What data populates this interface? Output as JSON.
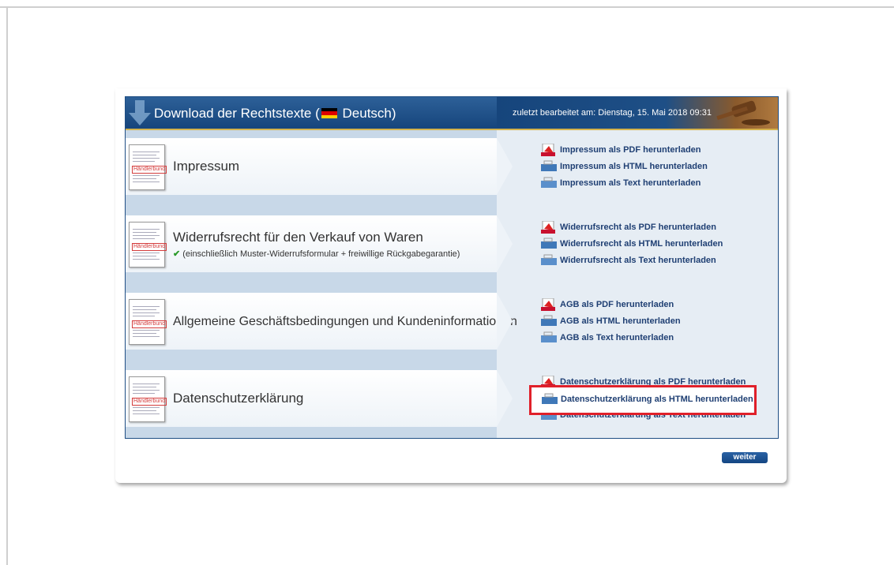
{
  "header": {
    "title_prefix": "Download der Rechtstexte (",
    "title_lang": "Deutsch)",
    "last_edited": "zuletzt bearbeitet am: Dienstag, 15. Mai 2018 09:31"
  },
  "colors": {
    "header_blue": "#1f4e84",
    "link_blue": "#1f3f73",
    "highlight_red": "#e0202a",
    "check_green": "#2a9a2a"
  },
  "thumb_stamp": "Händlerbund",
  "sections": [
    {
      "title": "Impressum",
      "subtitle": "",
      "links": [
        "Impressum als PDF herunterladen",
        "Impressum als HTML herunterladen",
        "Impressum als Text herunterladen"
      ]
    },
    {
      "title": "Widerrufsrecht für den Verkauf von Waren",
      "subtitle": "(einschließlich Muster-Widerrufsformular + freiwillige Rückgabegarantie)",
      "links": [
        "Widerrufsrecht als PDF herunterladen",
        "Widerrufsrecht als HTML herunterladen",
        "Widerrufsrecht als Text herunterladen"
      ]
    },
    {
      "title": "Allgemeine Geschäftsbedingungen und Kundeninformationen",
      "subtitle": "",
      "links": [
        "AGB als PDF herunterladen",
        "AGB als HTML herunterladen",
        "AGB als Text herunterladen"
      ]
    },
    {
      "title": "Datenschutzerklärung",
      "subtitle": "",
      "links": [
        "Datenschutzerklärung als PDF herunterladen",
        "Datenschutzerklärung als HTML herunterladen",
        "Datenschutzerklärung als Text herunterladen"
      ]
    }
  ],
  "icons": [
    "pdf-icon",
    "html-icon",
    "text-icon"
  ],
  "buttons": {
    "next": "weiter"
  }
}
